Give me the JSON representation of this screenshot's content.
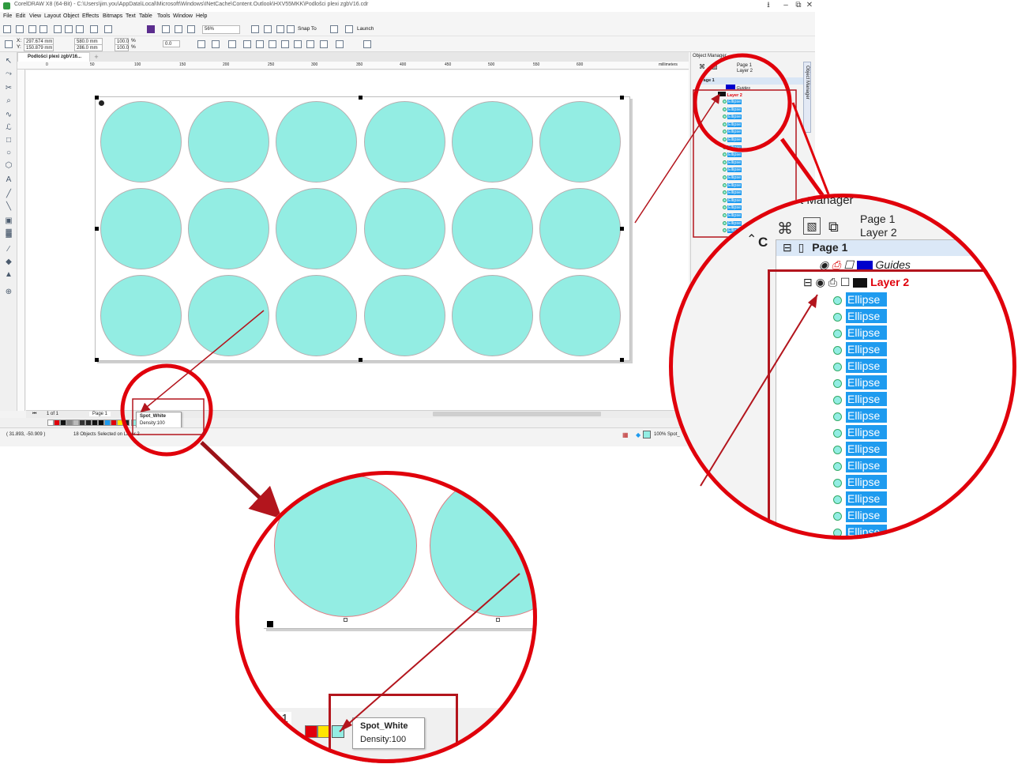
{
  "window": {
    "title": "CorelDRAW X8 (64-Bit) - C:\\Users\\jim.you\\AppData\\Local\\Microsoft\\Windows\\INetCache\\Content.Outlook\\HXV55MKK\\Podlošci plexi zgbV16.cdr",
    "controls": [
      "⭳",
      "–",
      "⧉",
      "✕"
    ]
  },
  "menu": [
    "File",
    "Edit",
    "View",
    "Layout",
    "Object",
    "Effects",
    "Bitmaps",
    "Text",
    "Table",
    "Tools",
    "Window",
    "Help"
  ],
  "toolbar": {
    "zoom": "56%",
    "snap_to": "Snap To",
    "launch": "Launch"
  },
  "property_bar": {
    "x": "297.674 mm",
    "y": "150.879 mm",
    "width": "580.0 mm",
    "height": "286.0 mm",
    "scale_x": "100.0",
    "scale_y": "100.0",
    "percent": "%",
    "rotation": "0.0"
  },
  "document_tab": "Podlošci plexi zgbV16...",
  "ruler": {
    "ticks": [
      "0",
      "50",
      "100",
      "150",
      "200",
      "250",
      "300",
      "350",
      "400",
      "450",
      "500",
      "550",
      "600"
    ],
    "unit": "millimeters"
  },
  "page_nav": {
    "counter": "1 of 1",
    "page_tab": "Page 1"
  },
  "tooltip": {
    "name": "Spot_White",
    "density": "Density:100"
  },
  "status": {
    "coords": "( 31.893, -50.909 )",
    "selection": "18 Objects Selected on Layer 2",
    "fill": "100% Spot_"
  },
  "object_manager": {
    "title": "Object Manager",
    "vertical_tab": "Object Manager",
    "header_page": "Page 1",
    "header_layer": "Layer 2",
    "page": "Page 1",
    "guides": "Guides",
    "layer": "Layer 2",
    "object_label": "Ellipse",
    "objects": [
      "Ellipse",
      "Ellipse",
      "Ellipse",
      "Ellipse",
      "Ellipse",
      "Ellipse",
      "Ellipse",
      "Ellipse",
      "Ellipse",
      "Ellipse",
      "Ellipse",
      "Ellipse",
      "Ellipse",
      "Ellipse",
      "Ellipse",
      "Ellipse",
      "Ellipse",
      "Ellipse"
    ]
  },
  "zoom_lens": {
    "title_fragment": "t Manager",
    "page_fragment": "e 1",
    "ellipse_cut": "Ellipse"
  },
  "colors": {
    "circle_fill": "#93ede3",
    "annotation_red": "#e0000b",
    "arrow_dark_red": "#b3151d",
    "selection_blue": "#1e9bef",
    "layer_red": "#e0000b"
  }
}
